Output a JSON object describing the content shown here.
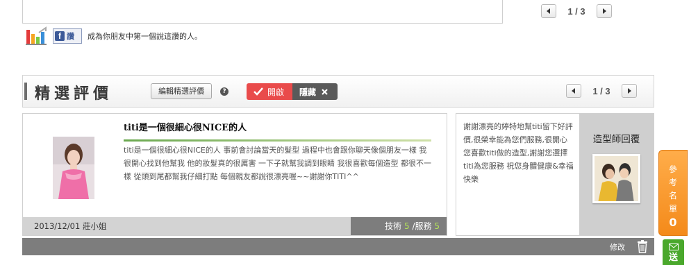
{
  "top_pager": {
    "text": "1 / 3"
  },
  "facebook": {
    "button_label": "讚",
    "like_text": "成為你朋友中第一個說這讚的人。"
  },
  "reviews": {
    "title": "精選評價",
    "edit_button": "編輯精選評價",
    "help": "?",
    "toggle_show": "開啟",
    "toggle_hide": "隱藏",
    "pager": "1 / 3",
    "card": {
      "title": "titi是一個很細心很NICE的人",
      "body": "titi是一個很細心很NICE的人 事前會討論當天的髮型 過程中也會跟你聊天像個朋友一樣 我很開心找到他幫我 他的妝髮真的很厲害 一下子就幫我調到眼睛 我很喜歡每個造型 都很不一樣 從頭到尾都幫我仔細打點 每個親友都說很漂亮喔~~謝謝你TITI^^",
      "date_author": "2013/12/01 莊小姐",
      "tech_label": "技術",
      "tech_score": "5",
      "sep": "/",
      "service_label": "服務",
      "service_score": "5"
    },
    "reply": {
      "text": "謝謝漂亮的婷特地幫titi留下好評價,很榮幸能為您們服務,很開心您喜歡titi做的造型,謝謝您選擇titi為您服務 祝您身體健康&幸福快樂",
      "side_title": "造型師回覆"
    },
    "bottom": {
      "modify": "修改"
    }
  },
  "side_tab": {
    "label_chars": [
      "參",
      "考",
      "名",
      "單"
    ],
    "count": "0"
  },
  "send_tab": {
    "label": "送"
  },
  "colors": {
    "accent_red": "#e94b4b",
    "orange_tab": "#f48a1a",
    "score_green": "#b5e35a",
    "send_green": "#4aa82c"
  }
}
